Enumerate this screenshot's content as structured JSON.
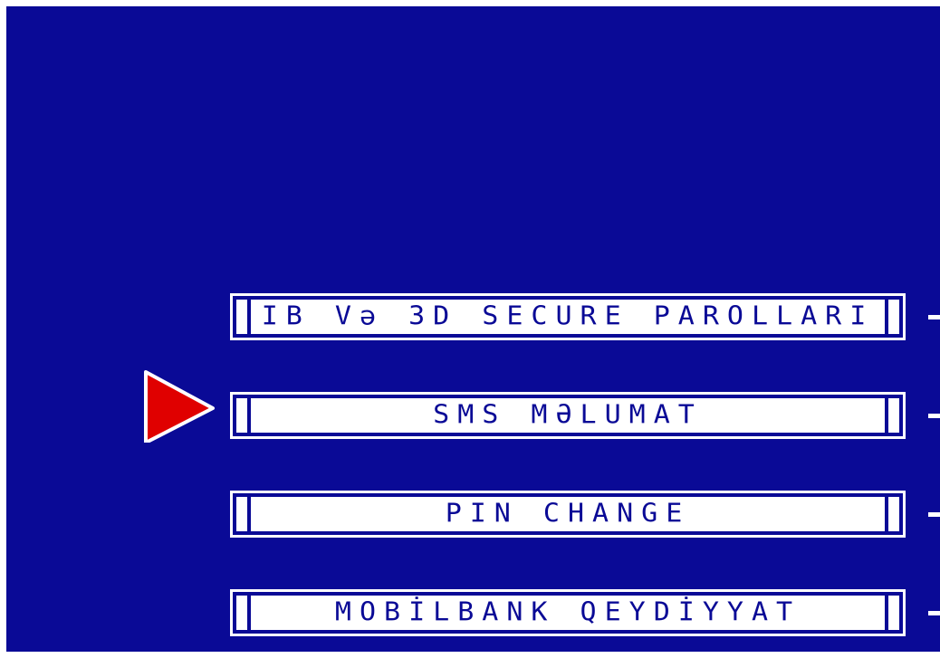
{
  "screen": {
    "background_color": "#0a0a96",
    "text_color": "#0a0a96",
    "button_face_color": "#ffffff",
    "pointer_color": "#e00000"
  },
  "menu": {
    "items": [
      {
        "label": "IB Və 3D SECURE PAROLLARI"
      },
      {
        "label": "SMS MƏLUMAT"
      },
      {
        "label": "PIN CHANGE"
      },
      {
        "label": "MOBİLBANK QEYDİYYAT"
      }
    ],
    "selected_index": 1
  },
  "icons": {
    "pointer": "red-triangle-pointer-icon"
  }
}
